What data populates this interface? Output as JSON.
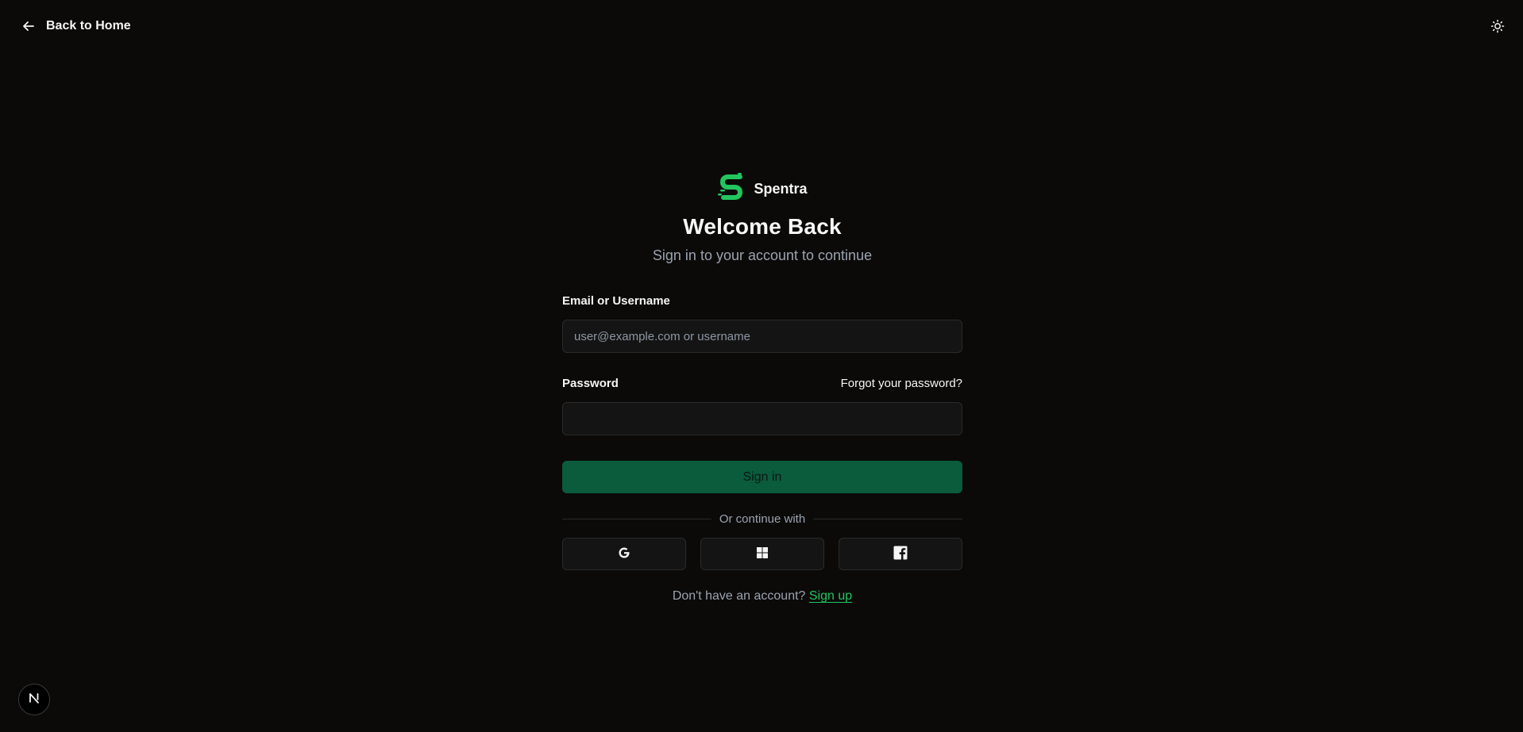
{
  "nav": {
    "back_label": "Back to Home",
    "back_icon": "arrow-left-icon",
    "theme_icon": "sun-icon"
  },
  "brand": {
    "name": "Spentra",
    "logo_icon": "spentra-s-logo",
    "color": "#22c55e"
  },
  "auth": {
    "title": "Welcome Back",
    "subtitle": "Sign in to your account to continue",
    "email_label": "Email or Username",
    "email_placeholder": "user@example.com or username",
    "email_value": "",
    "password_label": "Password",
    "password_value": "",
    "forgot_label": "Forgot your password?",
    "signin_label": "Sign in",
    "divider_label": "Or continue with",
    "social_providers": [
      {
        "name": "Google",
        "icon": "google-icon"
      },
      {
        "name": "Microsoft",
        "icon": "microsoft-icon"
      },
      {
        "name": "Facebook",
        "icon": "facebook-icon"
      }
    ],
    "signup_prompt": "Don't have an account?",
    "signup_link": "Sign up"
  },
  "dev_badge": {
    "label": "N",
    "icon": "nextjs-icon"
  },
  "colors": {
    "background": "#0b0a09",
    "accent": "#22c55e",
    "primary_button": "#0a5c3c",
    "muted_text": "#9ba3af"
  }
}
